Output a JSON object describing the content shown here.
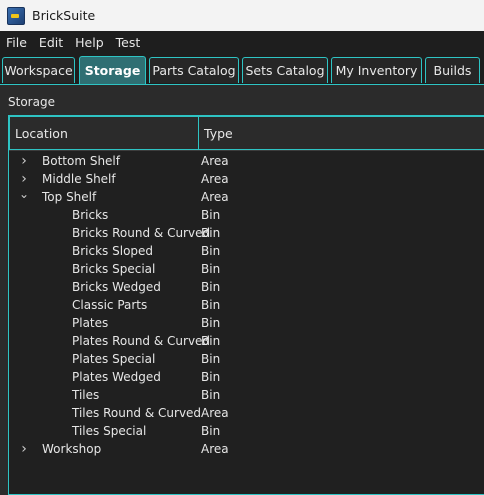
{
  "window": {
    "title": "BrickSuite"
  },
  "menu": [
    "File",
    "Edit",
    "Help",
    "Test"
  ],
  "tabs": [
    {
      "label": "Workspace",
      "active": false
    },
    {
      "label": "Storage",
      "active": true
    },
    {
      "label": "Parts Catalog",
      "active": false
    },
    {
      "label": "Sets Catalog",
      "active": false
    },
    {
      "label": "My Inventory",
      "active": false
    },
    {
      "label": "Builds",
      "active": false
    }
  ],
  "panel": {
    "label": "Storage"
  },
  "tree": {
    "columns": [
      "Location",
      "Type"
    ],
    "rows": [
      {
        "name": "Bottom Shelf",
        "type": "Area",
        "level": 0,
        "expander": "collapsed"
      },
      {
        "name": "Middle Shelf",
        "type": "Area",
        "level": 0,
        "expander": "collapsed"
      },
      {
        "name": "Top Shelf",
        "type": "Area",
        "level": 0,
        "expander": "expanded"
      },
      {
        "name": "Bricks",
        "type": "Bin",
        "level": 1,
        "expander": "none"
      },
      {
        "name": "Bricks Round & Curved",
        "type": "Bin",
        "level": 1,
        "expander": "none"
      },
      {
        "name": "Bricks Sloped",
        "type": "Bin",
        "level": 1,
        "expander": "none"
      },
      {
        "name": "Bricks Special",
        "type": "Bin",
        "level": 1,
        "expander": "none"
      },
      {
        "name": "Bricks Wedged",
        "type": "Bin",
        "level": 1,
        "expander": "none"
      },
      {
        "name": "Classic Parts",
        "type": "Bin",
        "level": 1,
        "expander": "none"
      },
      {
        "name": "Plates",
        "type": "Bin",
        "level": 1,
        "expander": "none"
      },
      {
        "name": "Plates Round & Curved",
        "type": "Bin",
        "level": 1,
        "expander": "none"
      },
      {
        "name": "Plates Special",
        "type": "Bin",
        "level": 1,
        "expander": "none"
      },
      {
        "name": "Plates Wedged",
        "type": "Bin",
        "level": 1,
        "expander": "none"
      },
      {
        "name": "Tiles",
        "type": "Bin",
        "level": 1,
        "expander": "none"
      },
      {
        "name": "Tiles Round & Curved",
        "type": "Area",
        "level": 1,
        "expander": "none"
      },
      {
        "name": "Tiles Special",
        "type": "Bin",
        "level": 1,
        "expander": "none"
      },
      {
        "name": "Workshop",
        "type": "Area",
        "level": 0,
        "expander": "collapsed"
      }
    ]
  },
  "colors": {
    "accent": "#2ec4c4",
    "active_tab": "#2f6f73",
    "background": "#2b2b2b"
  },
  "icons": {
    "app": "bricksuite-app-icon",
    "collapsed": "chevron-right-icon",
    "expanded": "chevron-down-icon"
  }
}
